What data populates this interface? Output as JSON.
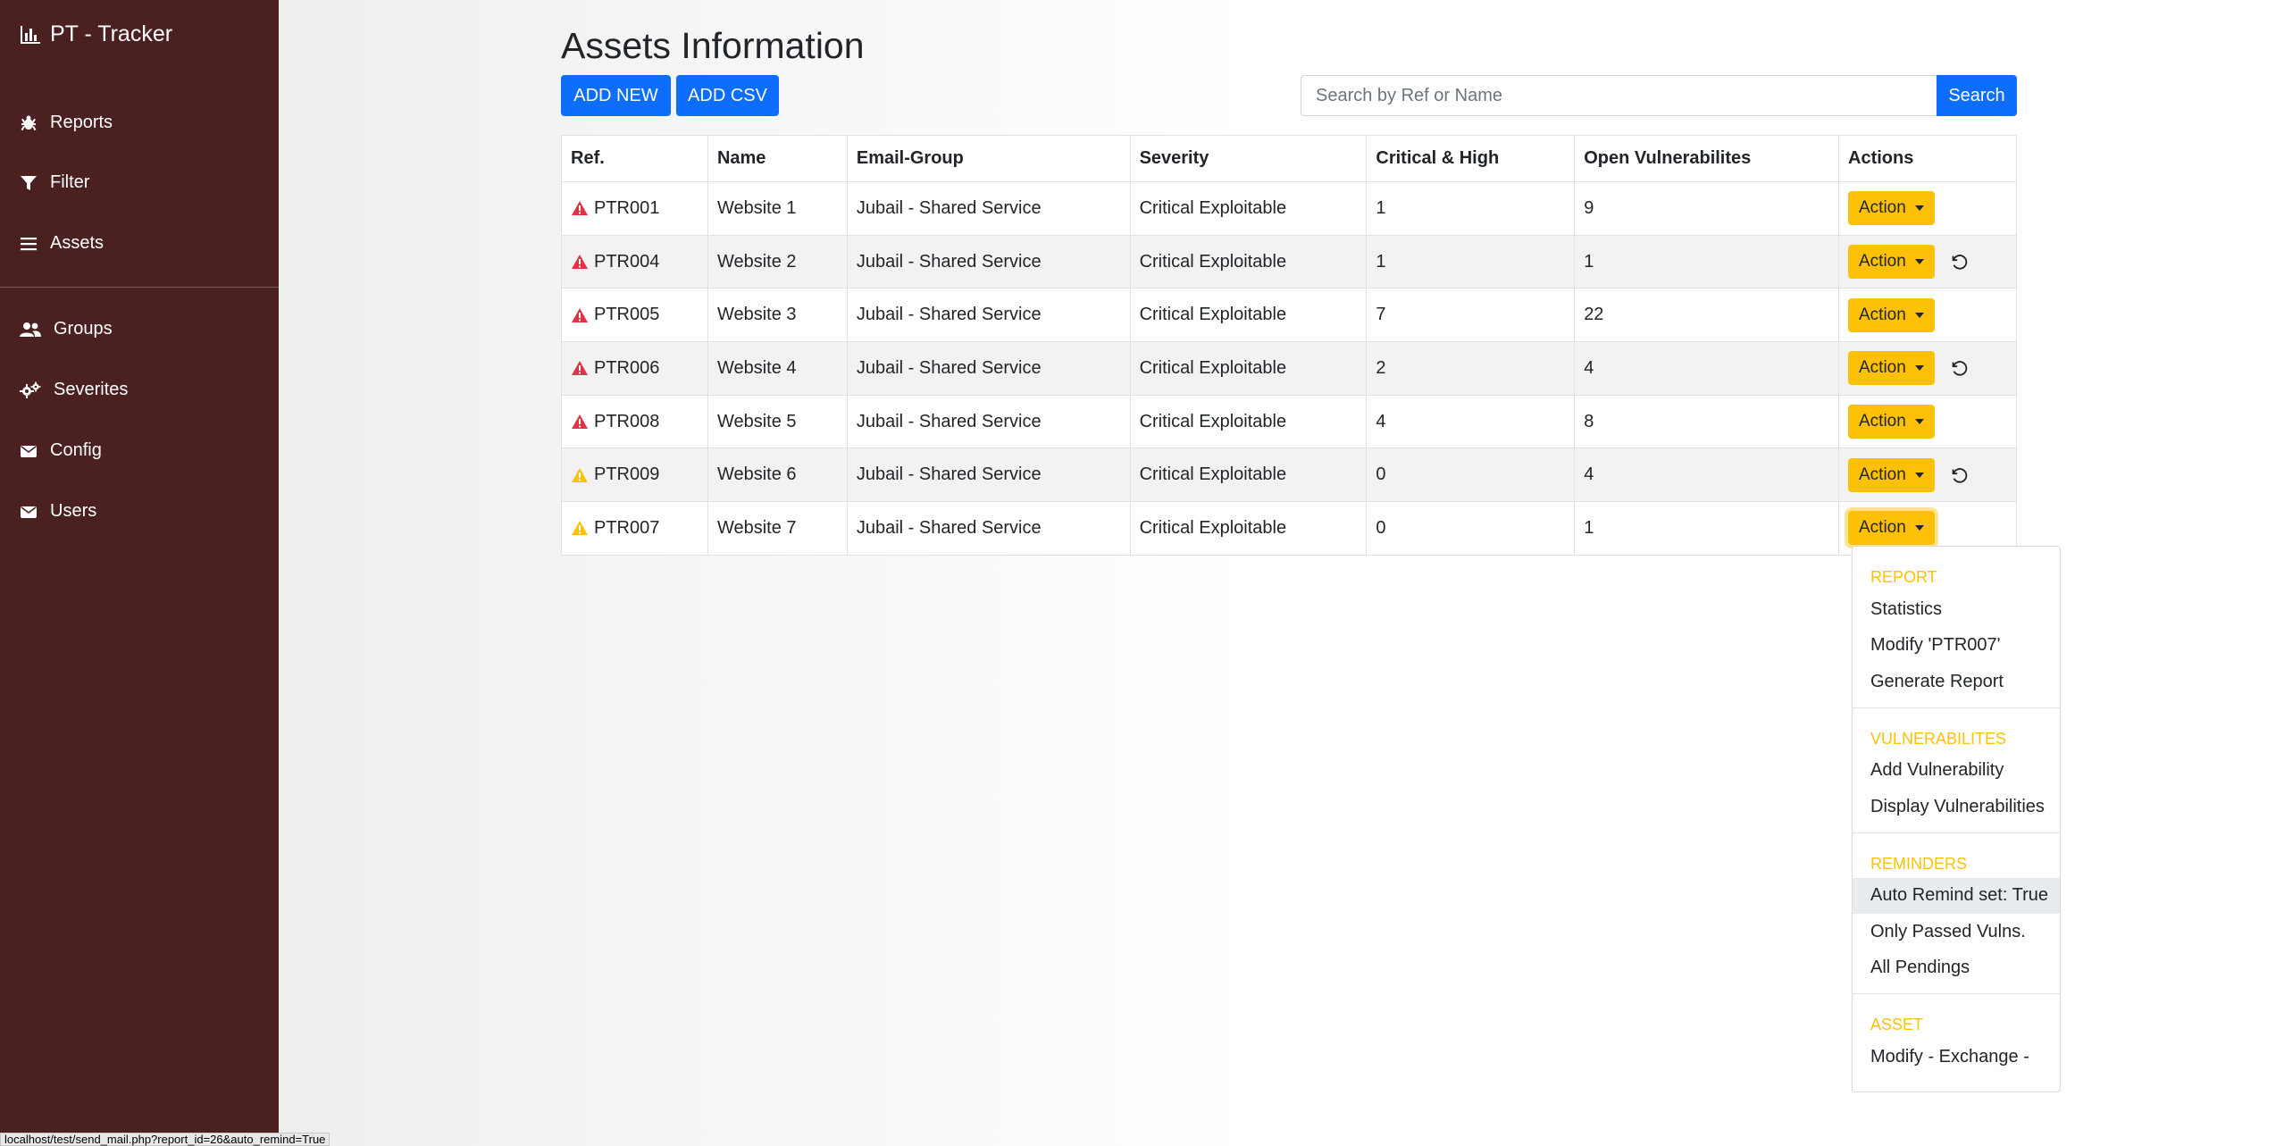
{
  "sidebar": {
    "brand": "PT - Tracker",
    "items": [
      {
        "label": "Reports",
        "icon": "bug-icon"
      },
      {
        "label": "Filter",
        "icon": "filter-icon"
      },
      {
        "label": "Assets",
        "icon": "list-icon"
      },
      {
        "label": "Groups",
        "icon": "users-icon"
      },
      {
        "label": "Severites",
        "icon": "gears-icon"
      },
      {
        "label": "Config",
        "icon": "envelope-icon"
      },
      {
        "label": "Users",
        "icon": "envelope-icon"
      }
    ]
  },
  "main": {
    "title": "Assets Information",
    "add_new_label": "ADD NEW",
    "add_csv_label": "ADD CSV",
    "search_placeholder": "Search by Ref or Name",
    "search_label": "Search"
  },
  "table": {
    "headers": [
      "Ref.",
      "Name",
      "Email-Group",
      "Severity",
      "Critical & High",
      "Open Vulnerabilites",
      "Actions"
    ],
    "rows": [
      {
        "ref": "PTR001",
        "name": "Website 1",
        "group": "Jubail - Shared Service",
        "severity": "Critical Exploitable",
        "critical_high": "1",
        "open": "9",
        "warning": "danger",
        "undo": false
      },
      {
        "ref": "PTR004",
        "name": "Website 2",
        "group": "Jubail - Shared Service",
        "severity": "Critical Exploitable",
        "critical_high": "1",
        "open": "1",
        "warning": "danger",
        "undo": true
      },
      {
        "ref": "PTR005",
        "name": "Website 3",
        "group": "Jubail - Shared Service",
        "severity": "Critical Exploitable",
        "critical_high": "7",
        "open": "22",
        "warning": "danger",
        "undo": false
      },
      {
        "ref": "PTR006",
        "name": "Website 4",
        "group": "Jubail - Shared Service",
        "severity": "Critical Exploitable",
        "critical_high": "2",
        "open": "4",
        "warning": "danger",
        "undo": true
      },
      {
        "ref": "PTR008",
        "name": "Website 5",
        "group": "Jubail - Shared Service",
        "severity": "Critical Exploitable",
        "critical_high": "4",
        "open": "8",
        "warning": "danger",
        "undo": false
      },
      {
        "ref": "PTR009",
        "name": "Website 6",
        "group": "Jubail - Shared Service",
        "severity": "Critical Exploitable",
        "critical_high": "0",
        "open": "4",
        "warning": "caution",
        "undo": true
      },
      {
        "ref": "PTR007",
        "name": "Website 7",
        "group": "Jubail - Shared Service",
        "severity": "Critical Exploitable",
        "critical_high": "0",
        "open": "1",
        "warning": "caution",
        "undo": false
      }
    ],
    "action_label": "Action"
  },
  "dropdown": {
    "sections": [
      {
        "header": "REPORT",
        "items": [
          "Statistics",
          "Modify 'PTR007'",
          "Generate Report"
        ]
      },
      {
        "header": "VULNERABILITES",
        "items": [
          "Add Vulnerability",
          "Display Vulnerabilities"
        ]
      },
      {
        "header": "REMINDERS",
        "items": [
          "Auto Remind set: True",
          "Only Passed Vulns.",
          "All Pendings"
        ]
      },
      {
        "header": "ASSET",
        "items": [
          "Modify - Exchange -"
        ]
      }
    ],
    "active_item": "Auto Remind set: True"
  },
  "status_url": "localhost/test/send_mail.php?report_id=26&auto_remind=True",
  "colors": {
    "sidebar_bg": "#4a2020",
    "primary": "#0d6efd",
    "warning": "#ffc107",
    "danger": "#dc3545"
  }
}
